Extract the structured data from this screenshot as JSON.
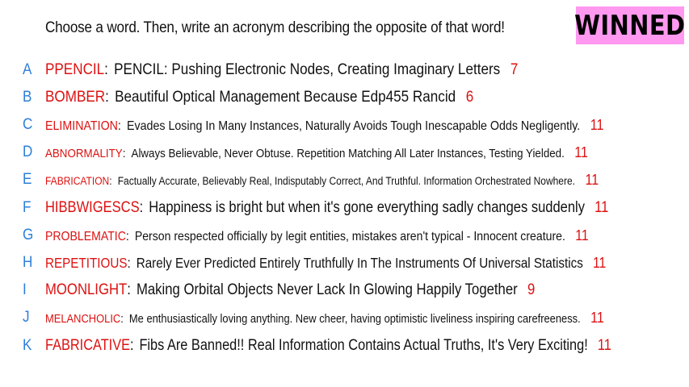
{
  "prompt": "Choose a word. Then, write an acronym describing the opposite of that word!",
  "badge": "WINNED",
  "colors": {
    "letter": "#2e7fd9",
    "word": "#dd1111",
    "count": "#dd1111",
    "badge_bg": "#ff99f0"
  },
  "entries": [
    {
      "letter": "A",
      "word": "PPENCIL",
      "acronym": "PENCIL: Pushing Electronic Nodes, Creating Imaginary Letters",
      "count": "7"
    },
    {
      "letter": "B",
      "word": "BOMBER",
      "acronym": "Beautiful Optical Management Because Edp455 Rancid",
      "count": "6"
    },
    {
      "letter": "C",
      "word": "ELIMINATION",
      "acronym": "Evades Losing In Many Instances, Naturally Avoids Tough Inescapable Odds Negligently.",
      "count": "11"
    },
    {
      "letter": "D",
      "word": "ABNORMALITY",
      "acronym": "Always Believable, Never Obtuse. Repetition Matching All Later Instances, Testing Yielded.",
      "count": "11"
    },
    {
      "letter": "E",
      "word": "FABRICATION",
      "acronym": "Factually Accurate, Believably Real, Indisputably Correct, And Truthful. Information Orchestrated Nowhere.",
      "count": "11"
    },
    {
      "letter": "F",
      "word": "HIBBWIGESCS",
      "acronym": "Happiness is bright but when it's gone everything sadly changes suddenly",
      "count": "11"
    },
    {
      "letter": "G",
      "word": "PROBLEMATIC",
      "acronym": "Person respected officially by legit entities, mistakes aren't typical - Innocent creature.",
      "count": "11"
    },
    {
      "letter": "H",
      "word": "REPETITIOUS",
      "acronym": "Rarely Ever Predicted Entirely Truthfully In The Instruments Of Universal Statistics",
      "count": "11"
    },
    {
      "letter": "I",
      "word": "MOONLIGHT",
      "acronym": "Making Orbital Objects Never Lack In Glowing Happily Together",
      "count": "9"
    },
    {
      "letter": "J",
      "word": "MELANCHOLIC",
      "acronym": "Me enthusiastically loving anything. New cheer, having optimistic liveliness inspiring carefreeness.",
      "count": "11"
    },
    {
      "letter": "K",
      "word": "FABRICATIVE",
      "acronym": "Fibs Are Banned!! Real Information Contains Actual Truths, It's Very Exciting!",
      "count": "11"
    }
  ]
}
